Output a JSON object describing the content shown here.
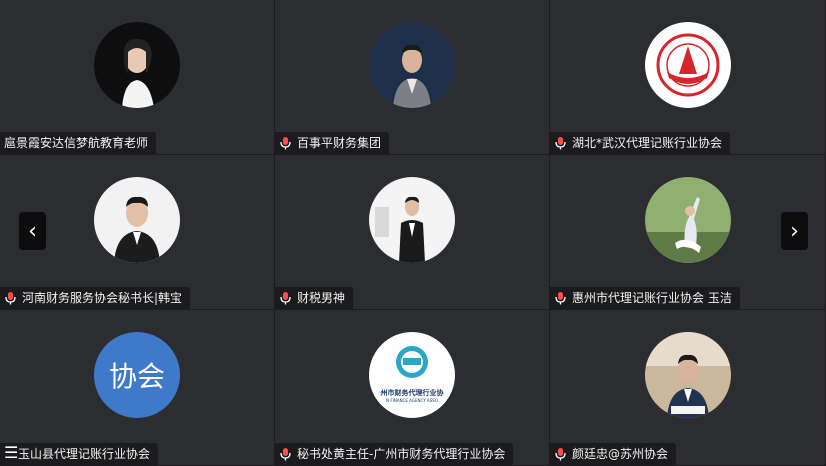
{
  "participants": [
    {
      "name": "扈景霞安达信梦航教育老师",
      "avatar": "woman-photo",
      "mic": false
    },
    {
      "name": "百事平财务集团",
      "avatar": "man-photo",
      "mic": true
    },
    {
      "name": "湖北*武汉代理记账行业协会",
      "avatar": "association-logo",
      "mic": true
    },
    {
      "name": "河南财务服务协会秘书长|韩宝",
      "avatar": "man-photo",
      "mic": true
    },
    {
      "name": "财税男神",
      "avatar": "man-photo",
      "mic": true
    },
    {
      "name": "惠州市代理记账行业协会 玉洁",
      "avatar": "dancer-photo",
      "mic": true
    },
    {
      "name": "玉山县代理记账行业协会",
      "avatar": "text-avatar",
      "avatar_text": "协会",
      "mic": false
    },
    {
      "name": "秘书处黄主任-广州市财务代理行业协会",
      "avatar": "gzfaa-logo",
      "logo_text": "州市财务代理行业协",
      "logo_sub": "N FINANCE AGENCY ASSO",
      "mic": true
    },
    {
      "name": "颜廷忠@苏州协会",
      "avatar": "man-photo",
      "mic": true
    }
  ],
  "nav": {
    "prev_icon": "chevron-left-icon",
    "next_icon": "chevron-right-icon",
    "prev_glyph": "‹",
    "next_glyph": "›"
  },
  "menu": {
    "icon": "menu-icon",
    "glyph": "☰"
  },
  "colors": {
    "tile_bg": "#2c2d30",
    "label_bg": "#1b1b1d",
    "text_avatar_bg": "#3f79c9"
  }
}
